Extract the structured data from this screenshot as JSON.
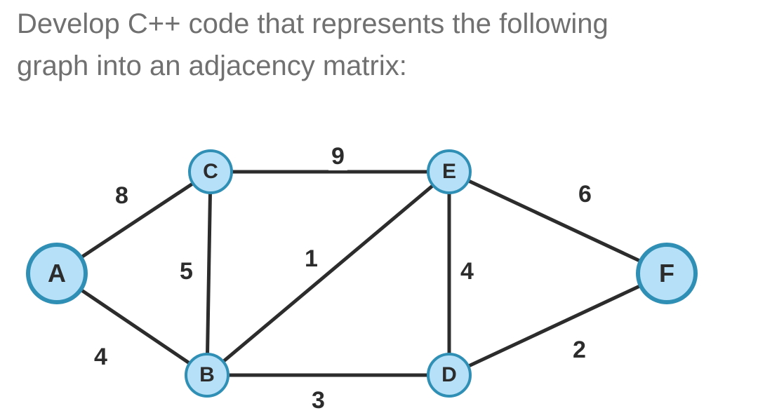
{
  "question": {
    "line1": "Develop C++ code that represents the following",
    "line2": "graph into an adjacency matrix:"
  },
  "graph": {
    "nodes": {
      "A": "A",
      "B": "B",
      "C": "C",
      "D": "D",
      "E": "E",
      "F": "F"
    },
    "edges": [
      {
        "from": "A",
        "to": "C",
        "weight": 8
      },
      {
        "from": "A",
        "to": "B",
        "weight": 4
      },
      {
        "from": "B",
        "to": "C",
        "weight": 5
      },
      {
        "from": "B",
        "to": "D",
        "weight": 3
      },
      {
        "from": "B",
        "to": "E",
        "weight": 1
      },
      {
        "from": "C",
        "to": "E",
        "weight": 9
      },
      {
        "from": "D",
        "to": "E",
        "weight": 4
      },
      {
        "from": "D",
        "to": "F",
        "weight": 2
      },
      {
        "from": "E",
        "to": "F",
        "weight": 6
      }
    ],
    "weights": {
      "AC": "8",
      "AB": "4",
      "BC": "5",
      "BD": "3",
      "BE": "1",
      "CE": "9",
      "DE": "4",
      "DF": "2",
      "EF": "6"
    }
  },
  "chart_data": {
    "type": "graph",
    "title": "",
    "directed": false,
    "nodes": [
      "A",
      "B",
      "C",
      "D",
      "E",
      "F"
    ],
    "edges": [
      {
        "u": "A",
        "v": "C",
        "w": 8
      },
      {
        "u": "A",
        "v": "B",
        "w": 4
      },
      {
        "u": "B",
        "v": "C",
        "w": 5
      },
      {
        "u": "B",
        "v": "D",
        "w": 3
      },
      {
        "u": "B",
        "v": "E",
        "w": 1
      },
      {
        "u": "C",
        "v": "E",
        "w": 9
      },
      {
        "u": "D",
        "v": "E",
        "w": 4
      },
      {
        "u": "D",
        "v": "F",
        "w": 2
      },
      {
        "u": "E",
        "v": "F",
        "w": 6
      }
    ],
    "adjacency_matrix_header": [
      "A",
      "B",
      "C",
      "D",
      "E",
      "F"
    ],
    "adjacency_matrix": [
      [
        0,
        4,
        8,
        0,
        0,
        0
      ],
      [
        4,
        0,
        5,
        3,
        1,
        0
      ],
      [
        8,
        5,
        0,
        0,
        9,
        0
      ],
      [
        0,
        3,
        0,
        0,
        4,
        2
      ],
      [
        0,
        1,
        9,
        4,
        0,
        6
      ],
      [
        0,
        0,
        0,
        2,
        6,
        0
      ]
    ]
  }
}
